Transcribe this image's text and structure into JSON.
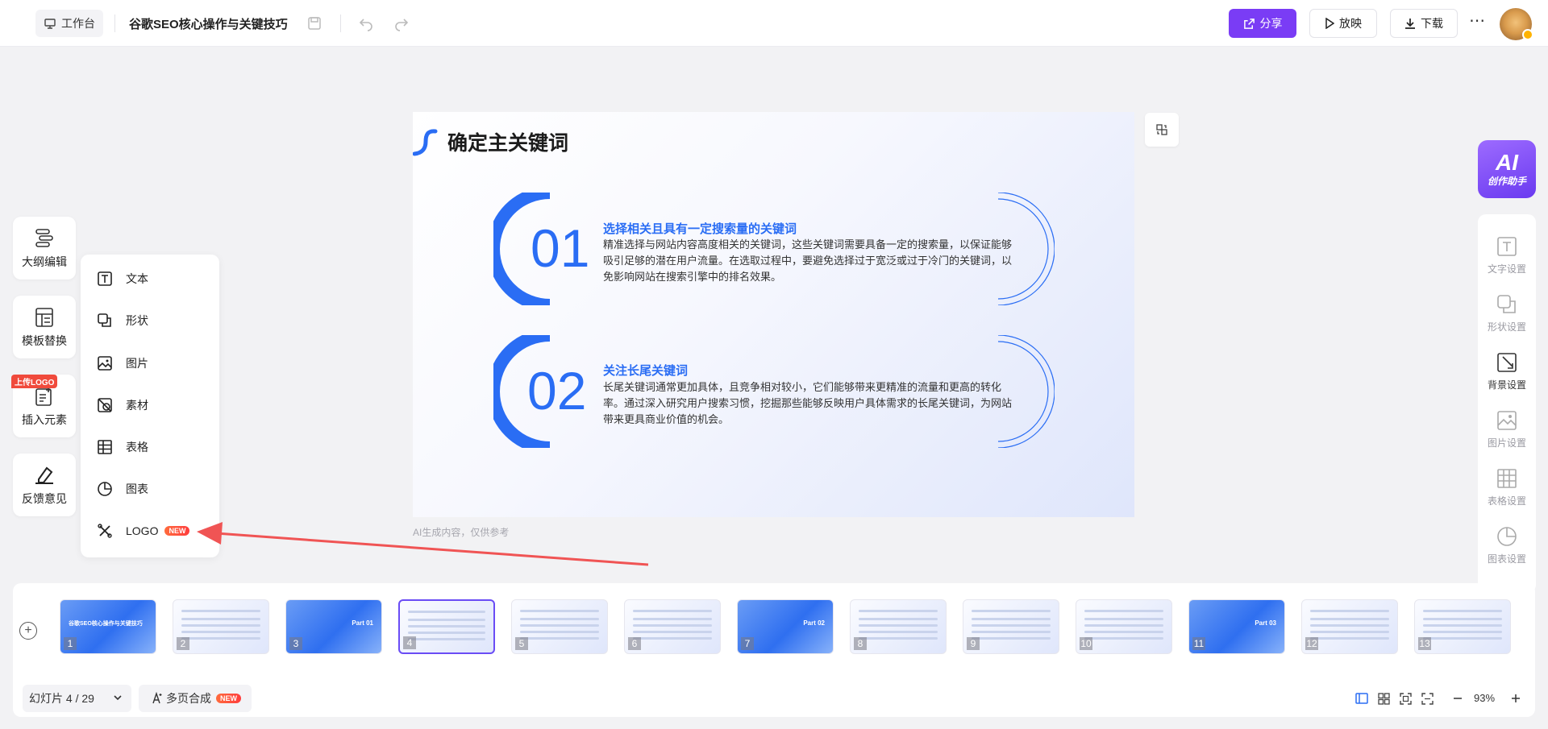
{
  "header": {
    "workspace_label": "工作台",
    "doc_title": "谷歌SEO核心操作与关键技巧",
    "share_label": "分享",
    "play_label": "放映",
    "download_label": "下载"
  },
  "slide": {
    "title": "确定主关键词",
    "items": [
      {
        "num": "01",
        "heading": "选择相关且具有一定搜索量的关键词",
        "body": "精准选择与网站内容高度相关的关键词，这些关键词需要具备一定的搜索量，以保证能够吸引足够的潜在用户流量。在选取过程中，要避免选择过于宽泛或过于冷门的关键词，以免影响网站在搜索引擎中的排名效果。"
      },
      {
        "num": "02",
        "heading": "关注长尾关键词",
        "body": "长尾关键词通常更加具体，且竞争相对较小，它们能够带来更精准的流量和更高的转化率。通过深入研究用户搜索习惯，挖掘那些能够反映用户具体需求的长尾关键词，为网站带来更具商业价值的机会。"
      }
    ],
    "ai_note": "AI生成内容，仅供参考"
  },
  "left_tools": [
    {
      "label": "大纲编辑",
      "icon": "outline-icon"
    },
    {
      "label": "模板替换",
      "icon": "template-icon"
    },
    {
      "label": "插入元素",
      "icon": "insert-icon",
      "tag": "上传LOGO"
    },
    {
      "label": "反馈意见",
      "icon": "feedback-icon"
    }
  ],
  "insert_menu": [
    {
      "label": "文本",
      "icon": "text-icon"
    },
    {
      "label": "形状",
      "icon": "shape-icon"
    },
    {
      "label": "图片",
      "icon": "image-icon"
    },
    {
      "label": "素材",
      "icon": "material-icon"
    },
    {
      "label": "表格",
      "icon": "table-icon"
    },
    {
      "label": "图表",
      "icon": "chart-icon"
    },
    {
      "label": "LOGO",
      "icon": "logo-icon",
      "badge": "NEW"
    }
  ],
  "right_panel": {
    "ai_title": "AI",
    "ai_subtitle": "创作助手",
    "items": [
      {
        "label": "文字设置",
        "icon": "text-settings-icon",
        "active": false
      },
      {
        "label": "形状设置",
        "icon": "shape-settings-icon",
        "active": false
      },
      {
        "label": "背景设置",
        "icon": "background-settings-icon",
        "active": true
      },
      {
        "label": "图片设置",
        "icon": "image-settings-icon",
        "active": false
      },
      {
        "label": "表格设置",
        "icon": "table-settings-icon",
        "active": false
      },
      {
        "label": "图表设置",
        "icon": "chart-settings-icon",
        "active": false
      }
    ]
  },
  "thumbnails": [
    {
      "n": "1",
      "kind": "cover",
      "text": "谷歌SEO核心操作与关键技巧"
    },
    {
      "n": "2",
      "kind": "toc"
    },
    {
      "n": "3",
      "kind": "part",
      "text": "Part 01"
    },
    {
      "n": "4",
      "kind": "content",
      "selected": true
    },
    {
      "n": "5",
      "kind": "content"
    },
    {
      "n": "6",
      "kind": "content"
    },
    {
      "n": "7",
      "kind": "part",
      "text": "Part 02"
    },
    {
      "n": "8",
      "kind": "content"
    },
    {
      "n": "9",
      "kind": "content"
    },
    {
      "n": "10",
      "kind": "content"
    },
    {
      "n": "11",
      "kind": "part",
      "text": "Part 03"
    },
    {
      "n": "12",
      "kind": "content"
    },
    {
      "n": "13",
      "kind": "content"
    }
  ],
  "footer": {
    "pager_label": "幻灯片 4 / 29",
    "merge_label": "多页合成",
    "merge_badge": "NEW",
    "zoom": "93%"
  },
  "colors": {
    "accent": "#7a3cf5",
    "slide_blue": "#2a6df4",
    "annotation_arrow": "#f05454"
  }
}
